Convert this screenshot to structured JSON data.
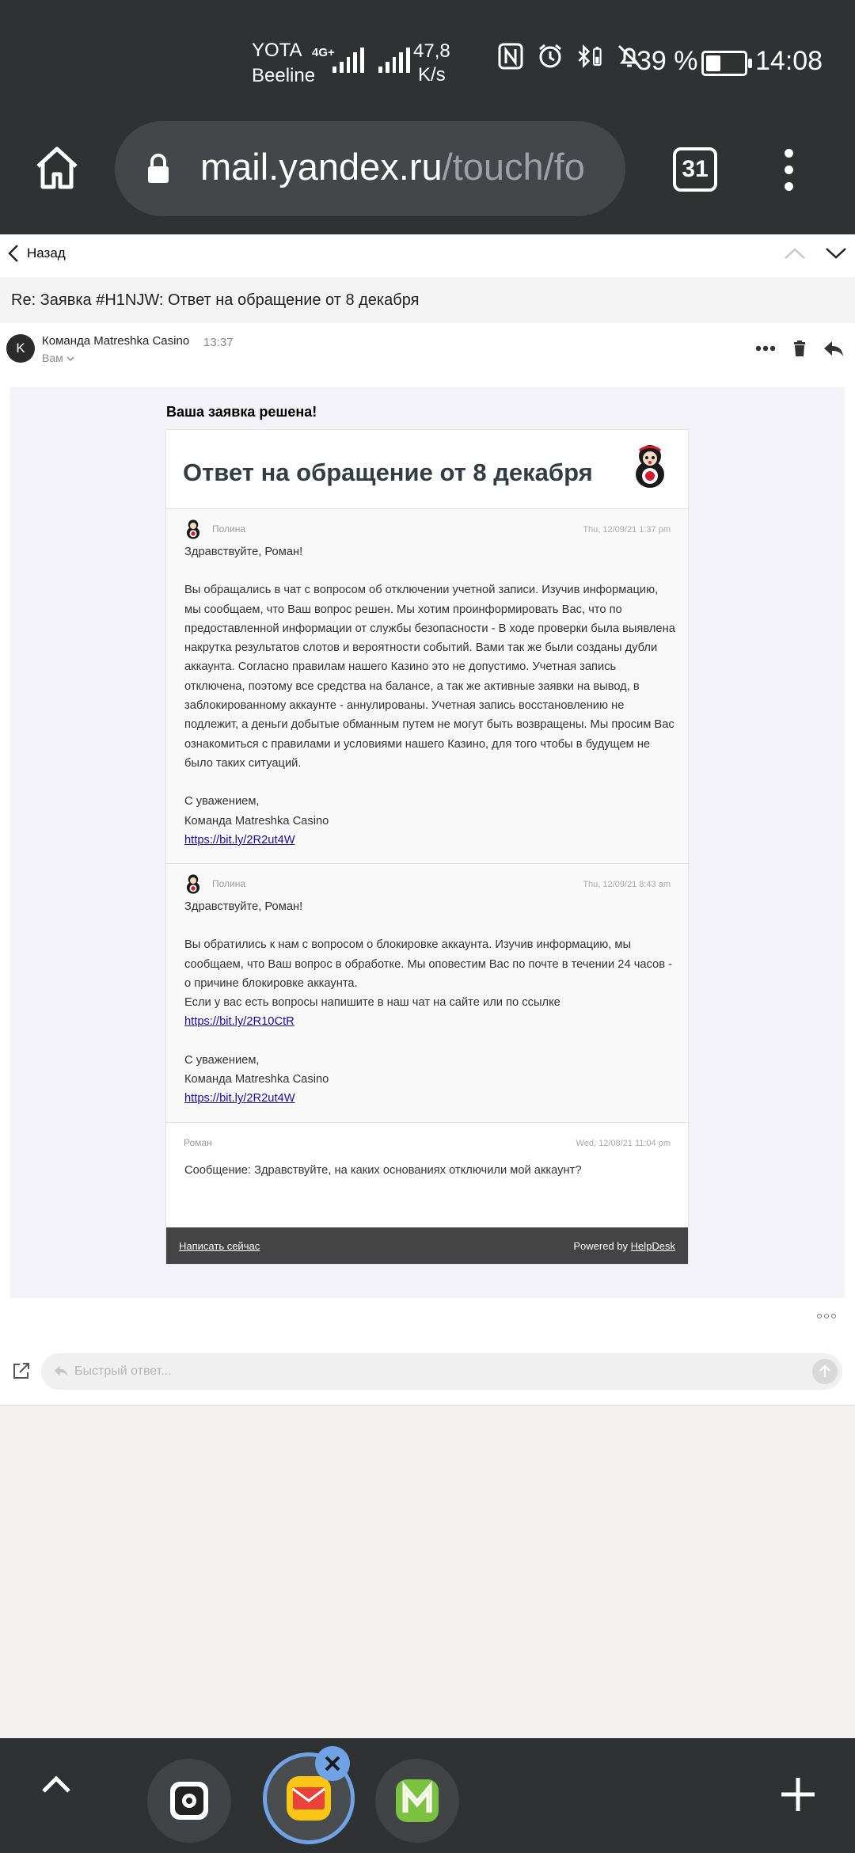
{
  "status_bar": {
    "carrier1": "YOTA",
    "carrier2": "Beeline",
    "network_type": "4G+",
    "speed_value": "47,8",
    "speed_unit": "K/s",
    "battery_percent": "39 %",
    "battery_level": 0.39,
    "time": "14:08"
  },
  "browser": {
    "url_host": "mail.yandex.ru",
    "url_path": "/touch/fo",
    "tab_count": "31"
  },
  "nav": {
    "back_label": "Назад"
  },
  "email": {
    "subject": "Re: Заявка #H1NJW: Ответ на обращение от 8 декабря",
    "sender_initial": "K",
    "sender_name": "Команда Matreshka Casino",
    "time": "13:37",
    "recipient": "Вам",
    "banner": "Ваша заявка решена!",
    "card_title": "Ответ на обращение от 8 декабря",
    "messages": [
      {
        "author": "Полина",
        "date": "Thu, 12/09/21 1:37 pm",
        "greeting": "Здравствуйте, Роман!",
        "body": "Вы обращались в чат с вопросом об отключении учетной записи. Изучив информацию, мы сообщаем, что Ваш вопрос решен. Мы хотим проинформировать Вас, что по предоставленной информации от службы безопасности - В ходе проверки была выявлена накрутка результатов слотов и вероятности событий. Вами так же были созданы дубли аккаунта. Согласно правилам нашего Казино это не допустимо. Учетная запись отключена, поэтому все средства на балансе, а так же активные заявки на вывод, в заблокированному аккаунте - аннулированы. Учетная запись восстановлению не подлежит, а деньги добытые обманным путем не могут быть возвращены. Мы просим Вас ознакомиться с правилами и условиями нашего Казино, для того чтобы в будущем не было таких ситуаций.",
        "regards": "С уважением,",
        "signature": "Команда Matreshka Casino",
        "link": "https://bit.ly/2R2ut4W"
      },
      {
        "author": "Полина",
        "date": "Thu, 12/09/21 8:43 am",
        "greeting": "Здравствуйте, Роман!",
        "body": "Вы обратились к нам с вопросом о блокировке аккаунта. Изучив информацию, мы сообщаем, что Ваш вопрос в обработке. Мы оповестим Вас по почте в течении 24 часов - о причине блокировке аккаунта.",
        "body2": "Если у вас есть вопросы напишите в наш чат на сайте или по ссылке",
        "chat_link": "https://bit.ly/2R10CtR",
        "regards": "С уважением,",
        "signature": "Команда Matreshka Casino",
        "link": "https://bit.ly/2R2ut4W"
      },
      {
        "author": "Роман",
        "date": "Wed, 12/08/21 11:04 pm",
        "body": "Сообщение: Здравствуйте, на каких основаниях отключили мой аккаунт?"
      }
    ],
    "footer_write": "Написать сейчас",
    "footer_powered": "Powered by",
    "footer_brand": "HelpDesk"
  },
  "quick_reply": {
    "placeholder": "Быстрый ответ..."
  },
  "colors": {
    "bar_bg": "#2f3133",
    "active_app_ring": "#6fa3e6",
    "mail_yellow": "#f9c616",
    "mail_red": "#e8423b",
    "green_app": "#7cc242"
  }
}
